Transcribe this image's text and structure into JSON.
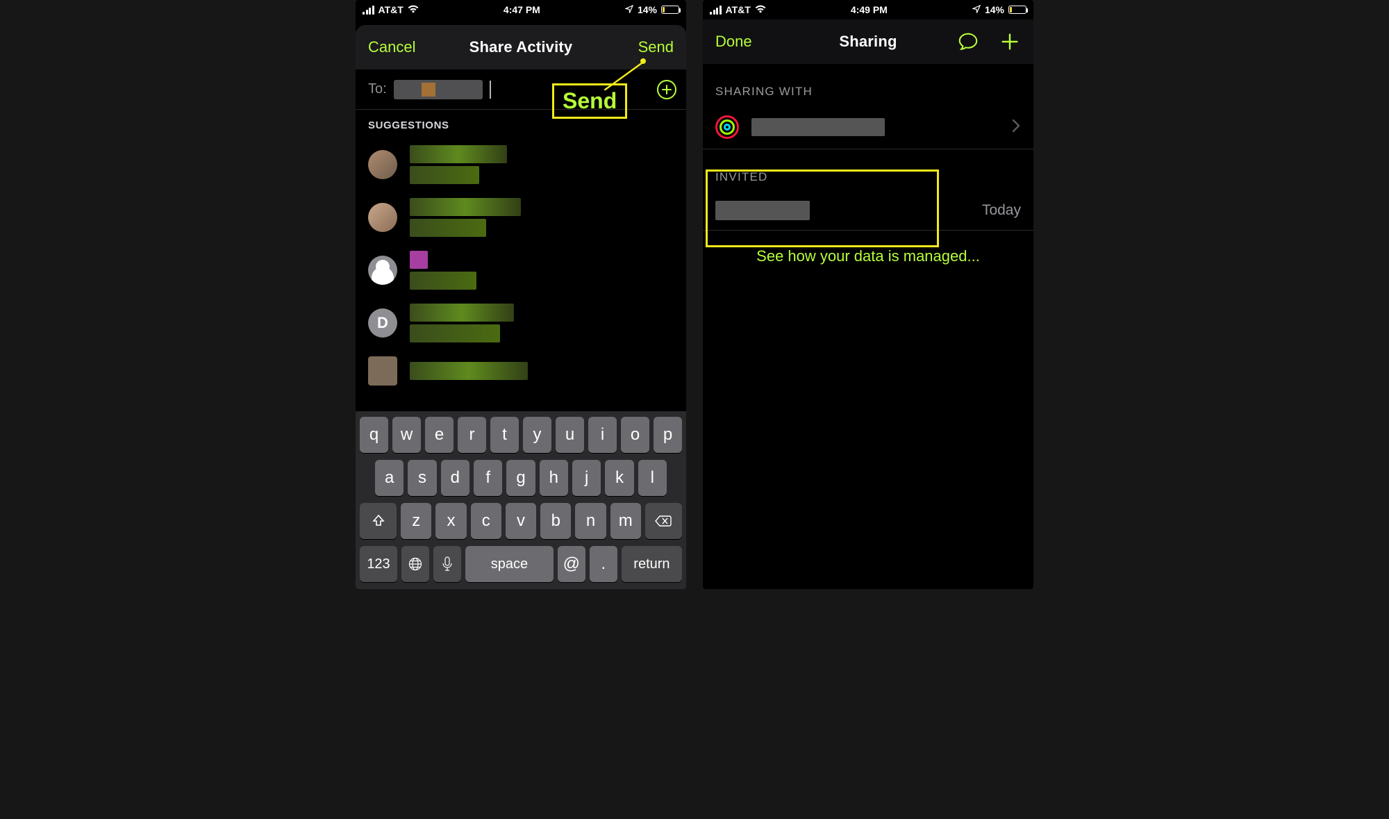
{
  "left": {
    "status": {
      "carrier": "AT&T",
      "time": "4:47 PM",
      "battery": "14%"
    },
    "nav": {
      "cancel": "Cancel",
      "title": "Share Activity",
      "send": "Send"
    },
    "to": {
      "label": "To:"
    },
    "callout_send": "Send",
    "suggestions_label": "SUGGESTIONS",
    "sugg_letter": "D",
    "keyboard": {
      "row1": [
        "q",
        "w",
        "e",
        "r",
        "t",
        "y",
        "u",
        "i",
        "o",
        "p"
      ],
      "row2": [
        "a",
        "s",
        "d",
        "f",
        "g",
        "h",
        "j",
        "k",
        "l"
      ],
      "row3": [
        "z",
        "x",
        "c",
        "v",
        "b",
        "n",
        "m"
      ],
      "num": "123",
      "space": "space",
      "at": "@",
      "dot": ".",
      "return": "return"
    }
  },
  "right": {
    "status": {
      "carrier": "AT&T",
      "time": "4:49 PM",
      "battery": "14%"
    },
    "nav": {
      "done": "Done",
      "title": "Sharing"
    },
    "sharing_with": "SHARING WITH",
    "invited": "INVITED",
    "today": "Today",
    "managed": "See how your data is managed..."
  }
}
